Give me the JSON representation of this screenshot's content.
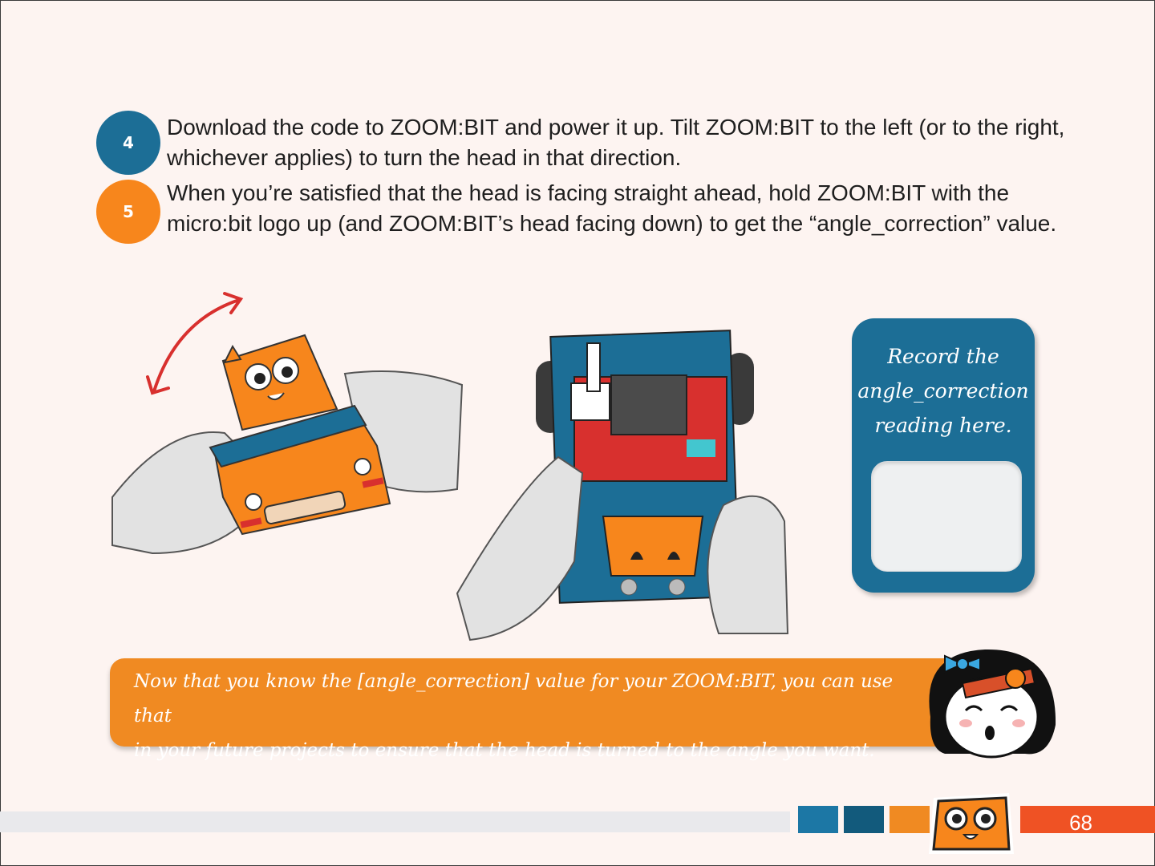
{
  "steps": [
    {
      "number": "4",
      "text": "Download the code to ZOOM:BIT and power it up. Tilt ZOOM:BIT to the left (or to the right, whichever applies) to turn the head in that direction."
    },
    {
      "number": "5",
      "text": "When you’re satisfied that the head is facing straight ahead, hold ZOOM:BIT with the micro:bit logo up (and ZOOM:BIT’s head facing down) to get the “angle_correction” value."
    }
  ],
  "record_box": {
    "line1": "Record the",
    "line2": "angle_correction",
    "line3": "reading here.",
    "input_value": ""
  },
  "banner": {
    "line1": "Now that you know the [angle_correction] value for your ZOOM:BIT, you can use that",
    "line2": "in your future projects to ensure that the head is turned to the angle you want."
  },
  "footer": {
    "page_number": "68"
  },
  "colors": {
    "blue": "#1c6e96",
    "orange": "#f7861c",
    "banner_orange": "#f08a22",
    "page_red": "#ef5224",
    "page_bg": "#fdf4f1"
  },
  "icons": [
    "robot-tilt-illustration",
    "robot-upside-down-illustration",
    "girl-mascot-icon",
    "zoombit-head-icon",
    "curved-arrow-icon"
  ]
}
